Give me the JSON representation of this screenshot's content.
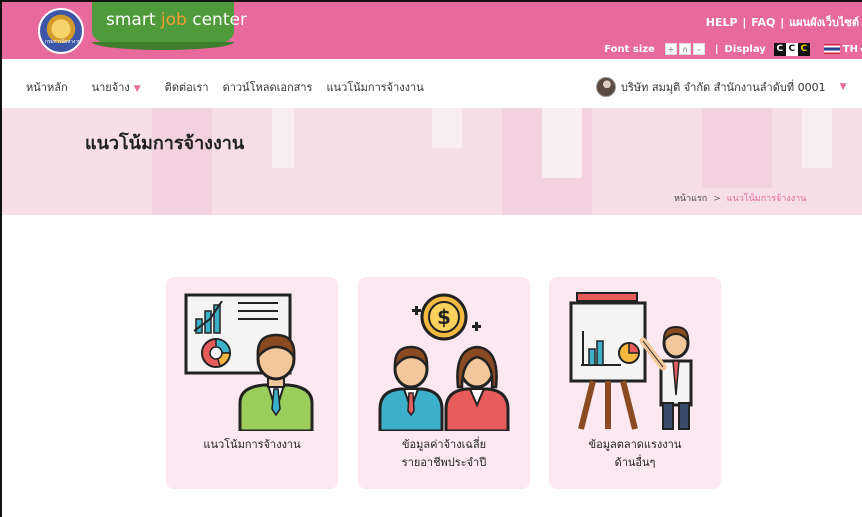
{
  "header": {
    "seal_text": "กรมการจัดหางาน",
    "brand_prefix": "smart",
    "brand_job": "job",
    "brand_suffix": "center",
    "links": [
      "HELP",
      "FAQ",
      "แผนผังเว็บไซต์"
    ],
    "font_size_label": "Font size",
    "font_size_options": [
      "+",
      "ก",
      "-"
    ],
    "display_label": "Display",
    "display_options": [
      "C",
      "C",
      "C"
    ],
    "language": "TH"
  },
  "nav": {
    "items": [
      "หน้าหลัก",
      "นายจ้าง",
      "ติดต่อเรา",
      "ดาวน์โหลดเอกสาร",
      "แนวโน้มการจ้างงาน"
    ],
    "user_name": "บริษัท สมมุติ จำกัด สำนักงานลำดับที่ 0001"
  },
  "banner": {
    "title": "แนวโน้มการจ้างงาน",
    "breadcrumb_home": "หน้าแรก",
    "breadcrumb_sep": ">",
    "breadcrumb_current": "แนวโน้มการจ้างงาน"
  },
  "cards": [
    {
      "line1": "แนวโน้มการจ้างงาน",
      "line2": "",
      "icon": "presentation-analyst-icon"
    },
    {
      "line1": "ข้อมูลค่าจ้างเฉลี่ย",
      "line2": "รายอาชีพประจำปี",
      "icon": "wage-coin-people-icon"
    },
    {
      "line1": "ข้อมูลตลาดแรงงาน",
      "line2": "ด้านอื่นๆ",
      "icon": "presenter-easel-icon"
    }
  ],
  "colors": {
    "header_bg": "#e8699c",
    "brand_green": "#4f9a3b",
    "banner_bg": "#f7dfe8",
    "card_bg": "#fbe8f0",
    "accent": "#e8699c"
  }
}
